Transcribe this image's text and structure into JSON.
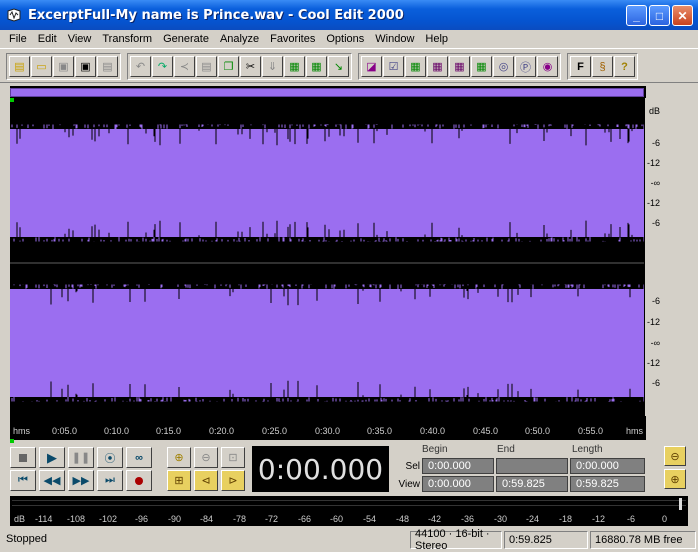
{
  "window": {
    "title": "ExcerptFull-My name is Prince.wav - Cool Edit 2000"
  },
  "menu": [
    "File",
    "Edit",
    "View",
    "Transform",
    "Generate",
    "Analyze",
    "Favorites",
    "Options",
    "Window",
    "Help"
  ],
  "ruler": {
    "unit": "dB",
    "channel1": [
      "-6",
      "-12",
      "-∞",
      "-12",
      "-6"
    ],
    "channel2": [
      "-6",
      "-12",
      "-∞",
      "-12",
      "-6"
    ]
  },
  "timeline": {
    "start": "hms",
    "ticks": [
      "0:05.0",
      "0:10.0",
      "0:15.0",
      "0:20.0",
      "0:25.0",
      "0:30.0",
      "0:35.0",
      "0:40.0",
      "0:45.0",
      "0:50.0",
      "0:55.0"
    ],
    "end": "hms"
  },
  "time_display": "0:00.000",
  "selection": {
    "headers": {
      "begin": "Begin",
      "end": "End",
      "length": "Length"
    },
    "sel": {
      "label": "Sel",
      "begin": "0:00.000",
      "end": "",
      "length": "0:00.000"
    },
    "view": {
      "label": "View",
      "begin": "0:00.000",
      "end": "0:59.825",
      "length": "0:59.825"
    }
  },
  "meter": {
    "labels": [
      "dB",
      "-114",
      "-108",
      "-102",
      "-96",
      "-90",
      "-84",
      "-78",
      "-72",
      "-66",
      "-60",
      "-54",
      "-48",
      "-42",
      "-36",
      "-30",
      "-24",
      "-18",
      "-12",
      "-6",
      "0"
    ]
  },
  "status": {
    "state": "Stopped",
    "format": "44100 · 16-bit · Stereo",
    "duration": "0:59.825",
    "free": "16880.78 MB free"
  },
  "colors": {
    "waveform": "#9b6ef0",
    "title_bar": "#0554d0"
  }
}
